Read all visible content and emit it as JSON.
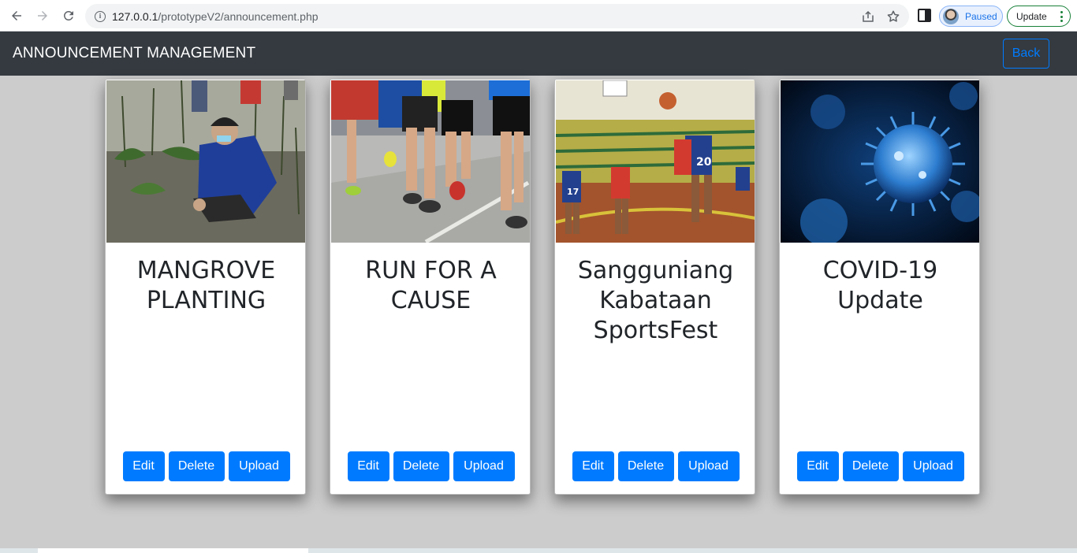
{
  "browser": {
    "url_host": "127.0.0.1",
    "url_path": "/prototypeV2/announcement.php",
    "profile_status": "Paused",
    "update_label": "Update",
    "icons": [
      "back-arrow-icon",
      "forward-arrow-icon",
      "reload-icon",
      "site-info-icon",
      "share-icon",
      "bookmark-star-icon",
      "side-panel-icon",
      "more-menu-icon"
    ]
  },
  "navbar": {
    "title": "ANNOUNCEMENT MANAGEMENT",
    "back_label": "Back"
  },
  "cards": [
    {
      "title": "MANGROVE PLANTING",
      "image": "mangrove-planting-photo",
      "edit_label": "Edit",
      "delete_label": "Delete",
      "upload_label": "Upload"
    },
    {
      "title": "RUN FOR A CAUSE",
      "image": "fun-run-photo",
      "edit_label": "Edit",
      "delete_label": "Delete",
      "upload_label": "Upload"
    },
    {
      "title": "Sangguniang Kabataan SportsFest",
      "image": "basketball-game-photo",
      "edit_label": "Edit",
      "delete_label": "Delete",
      "upload_label": "Upload"
    },
    {
      "title": "COVID-19 Update",
      "image": "coronavirus-photo",
      "edit_label": "Edit",
      "delete_label": "Delete",
      "upload_label": "Upload"
    }
  ],
  "colors": {
    "navbar_bg": "#343a40",
    "primary": "#007bff",
    "page_bg": "#cccccc",
    "card_bg": "#ffffff",
    "title_text": "#212529"
  }
}
